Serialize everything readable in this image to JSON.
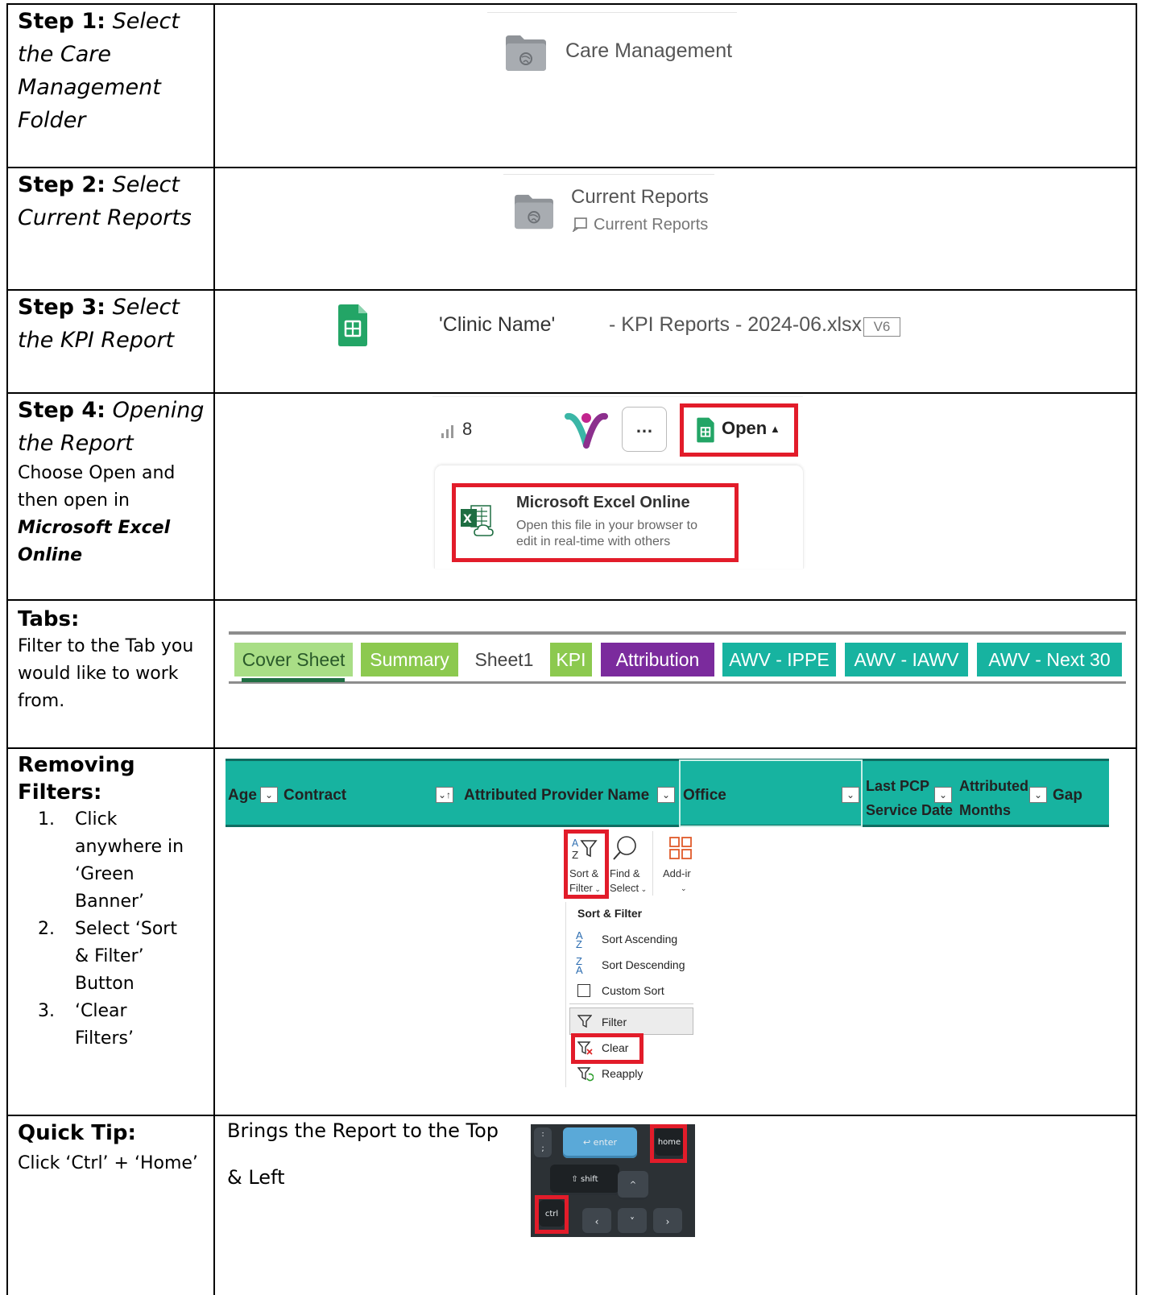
{
  "rows": {
    "step1": {
      "label_bold": "Step 1:",
      "label_italic": "Select the Care Management Folder",
      "folder_name": "Care Management"
    },
    "step2": {
      "label_bold": "Step 2:",
      "label_italic": "Select Current Reports",
      "folder_title": "Current Reports",
      "folder_subtitle": "Current Reports"
    },
    "step3": {
      "label_bold": "Step 3:",
      "label_italic": "Select the KPI Report",
      "clinic_name": "'Clinic Name'",
      "file_name": "- KPI Reports - 2024-06.xlsx",
      "version": "V6"
    },
    "step4": {
      "label_bold": "Step 4:",
      "label_italic": "Opening the Report",
      "desc_line1": "Choose Open and",
      "desc_line2": "then open in",
      "desc_emph1": "Microsoft Excel",
      "desc_emph2": "Online",
      "signal_count": "8",
      "more_label": "…",
      "open_label": "Open",
      "excel_title": "Microsoft Excel Online",
      "excel_desc1": "Open this file in your browser to",
      "excel_desc2": "edit in real-time with others"
    },
    "tabs": {
      "label": "Tabs:",
      "desc1": "Filter to the Tab you",
      "desc2": "would like to work",
      "desc3": "from.",
      "sheet_tabs": [
        "Cover Sheet",
        "Summary",
        "Sheet1",
        "KPI",
        "Attribution",
        "AWV - IPPE",
        "AWV - IAWV",
        "AWV - Next 30"
      ]
    },
    "filters": {
      "label": "Removing Filters:",
      "items": [
        {
          "num": "1.",
          "lines": [
            "Click",
            "anywhere in",
            "‘Green",
            "Banner’"
          ]
        },
        {
          "num": "2.",
          "lines": [
            "Select ‘Sort",
            "& Filter’",
            "Button"
          ]
        },
        {
          "num": "3.",
          "lines": [
            "‘Clear",
            "Filters’"
          ]
        }
      ],
      "headers": {
        "age": "Age",
        "contract": "Contract",
        "provider": "Attributed Provider Name",
        "office": "Office",
        "last_pcp_1": "Last PCP",
        "last_pcp_2": "Service Date",
        "attributed_1": "Attributed",
        "attributed_2": "Months",
        "gap": "Gap"
      },
      "ribbon": {
        "sort_filter_1": "Sort &",
        "sort_filter_2": "Filter",
        "find_select_1": "Find &",
        "find_select_2": "Select",
        "addins": "Add-ir"
      },
      "menu": {
        "title": "Sort & Filter",
        "sort_asc": "Sort Ascending",
        "sort_desc": "Sort Descending",
        "custom_sort": "Custom Sort",
        "filter": "Filter",
        "clear": "Clear",
        "reapply": "Reapply"
      }
    },
    "tip": {
      "label": "Quick Tip:",
      "desc": "Click ‘Ctrl’ + ‘Home’",
      "text1": "Brings the Report to the Top",
      "text2": "& Left",
      "keys": {
        "enter": "↩ enter",
        "home": "home",
        "shift": "⇧ shift",
        "ctrl": "ctrl",
        "up": "^",
        "down": "˅",
        "left": "‹",
        "right": "›"
      }
    }
  },
  "colors": {
    "teal": "#17b3a0",
    "green_light": "#a9de86",
    "green": "#8cc94f",
    "purple": "#7b2b9d",
    "red": "#e21c2a"
  }
}
